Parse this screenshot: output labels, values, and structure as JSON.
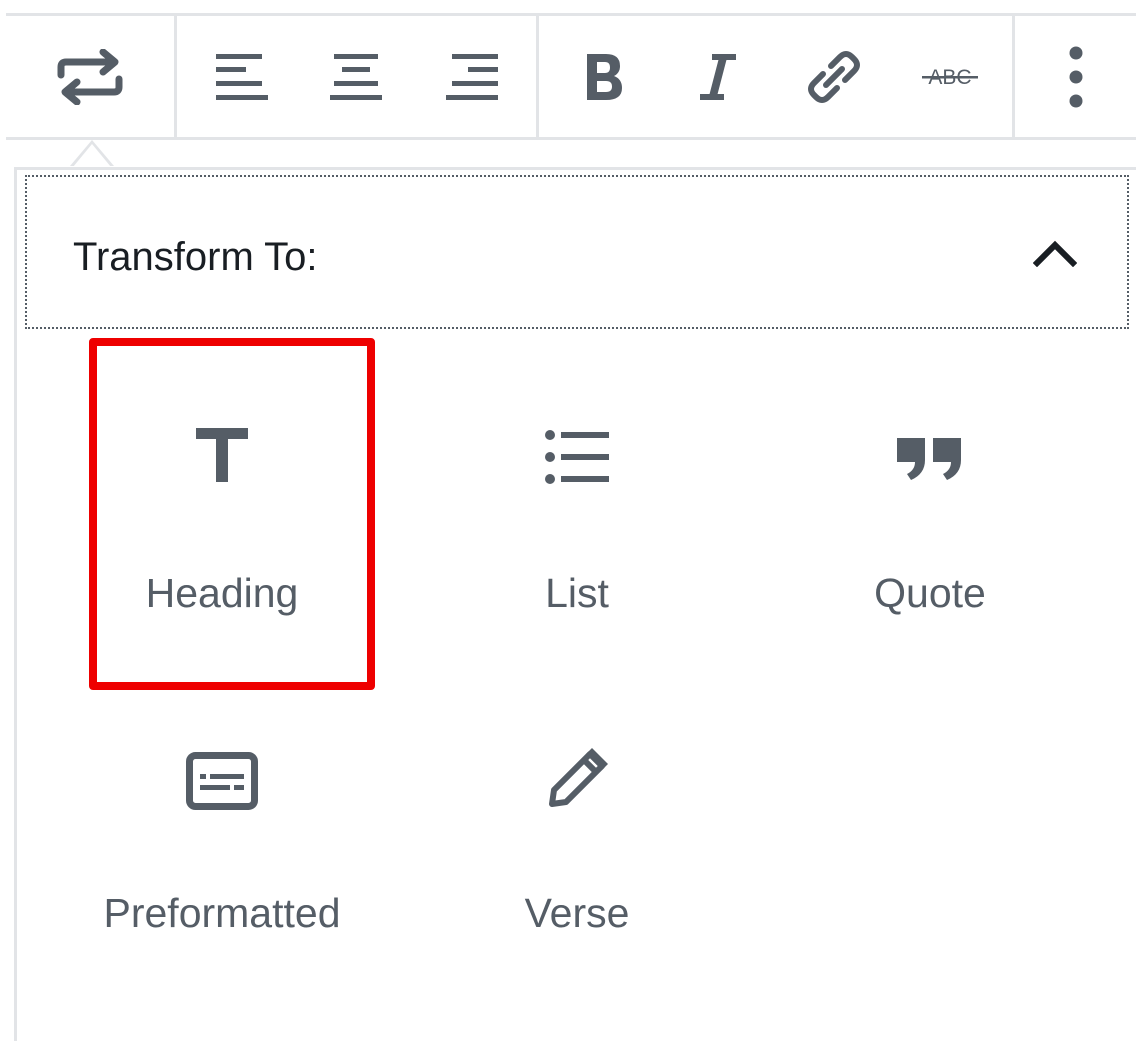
{
  "toolbar": {
    "buttons": [
      {
        "name": "transform-button",
        "icon": "arrows-swap-icon"
      },
      {
        "name": "align-left-button",
        "icon": "align-left-icon"
      },
      {
        "name": "align-center-button",
        "icon": "align-center-icon"
      },
      {
        "name": "align-right-button",
        "icon": "align-right-icon"
      },
      {
        "name": "bold-button",
        "icon": "bold-icon"
      },
      {
        "name": "italic-button",
        "icon": "italic-icon"
      },
      {
        "name": "link-button",
        "icon": "link-icon"
      },
      {
        "name": "strikethrough-button",
        "icon": "strikethrough-icon",
        "glyph_text": "ABC"
      },
      {
        "name": "more-options-button",
        "icon": "vertical-ellipsis-icon"
      }
    ]
  },
  "transform_panel": {
    "title": "Transform To:",
    "expanded": true,
    "toggle_icon": "chevron-up-icon",
    "items": [
      {
        "label": "Heading",
        "icon": "heading-icon",
        "highlighted": true
      },
      {
        "label": "List",
        "icon": "list-icon",
        "highlighted": false
      },
      {
        "label": "Quote",
        "icon": "quote-icon",
        "highlighted": false
      },
      {
        "label": "Preformatted",
        "icon": "preformatted-icon",
        "highlighted": false
      },
      {
        "label": "Verse",
        "icon": "pencil-icon",
        "highlighted": false
      }
    ]
  },
  "colors": {
    "icon": "#555d66",
    "border": "#e2e4e7",
    "highlight": "#ee0000",
    "title_text": "#191e23"
  }
}
